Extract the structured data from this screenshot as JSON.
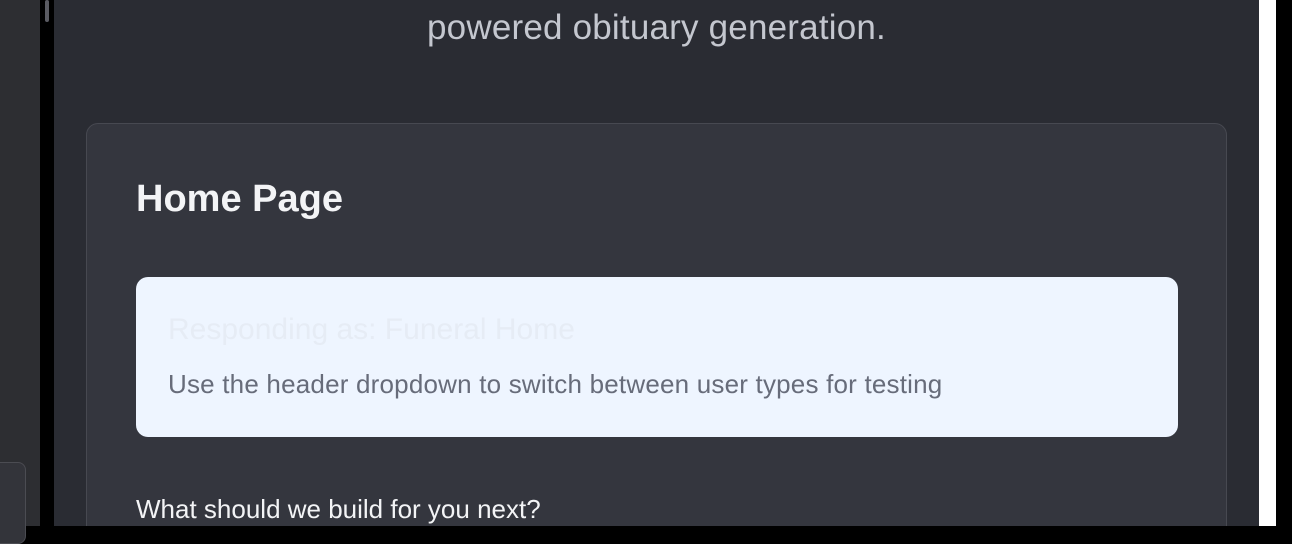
{
  "tagline": "powered obituary generation.",
  "card": {
    "title": "Home Page",
    "info": {
      "title": "Responding as: Funeral Home",
      "description": "Use the header dropdown to switch between user types for testing"
    },
    "question": "What should we build for you next?"
  },
  "colors": {
    "panel_bg": "#2a2c33",
    "card_bg": "#34363e",
    "info_bg": "#eef5ff",
    "title_text": "#f3f4f6",
    "muted_text": "#676c7a"
  }
}
